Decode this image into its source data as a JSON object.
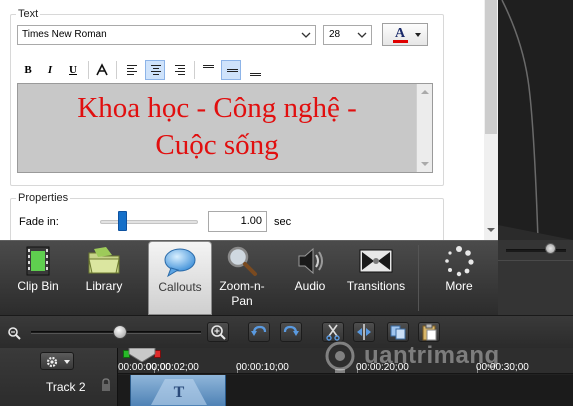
{
  "text_group": {
    "title": "Text",
    "font": "Times New Roman",
    "size": "28",
    "color": "#e10f0f",
    "format_buttons": [
      "B",
      "I",
      "U"
    ],
    "content_line1": "Khoa học - Công nghệ -",
    "content_line2": "Cuộc sống"
  },
  "properties_group": {
    "title": "Properties",
    "fade_label": "Fade in:",
    "fade_value": "1.00",
    "fade_unit": "sec"
  },
  "tabs": [
    {
      "label": "Clip Bin",
      "icon": "film-strip-icon"
    },
    {
      "label": "Library",
      "icon": "folder-icon"
    },
    {
      "label": "Callouts",
      "icon": "speech-bubble-icon",
      "selected": true
    },
    {
      "label": "Zoom-n-Pan",
      "label_line1": "Zoom-n-",
      "label_line2": "Pan",
      "icon": "magnifier-icon"
    },
    {
      "label": "Audio",
      "icon": "speaker-icon"
    },
    {
      "label": "Transitions",
      "icon": "transitions-icon"
    },
    {
      "label": "More",
      "icon": "dots-spinner-icon"
    }
  ],
  "timeline": {
    "track_label": "Track 2",
    "ruler": [
      "00:00:00;00",
      "00:00:02;00",
      "00:00:10;00",
      "00:00:20;00",
      "00:00:30;00"
    ]
  },
  "watermark": "uantrimang"
}
